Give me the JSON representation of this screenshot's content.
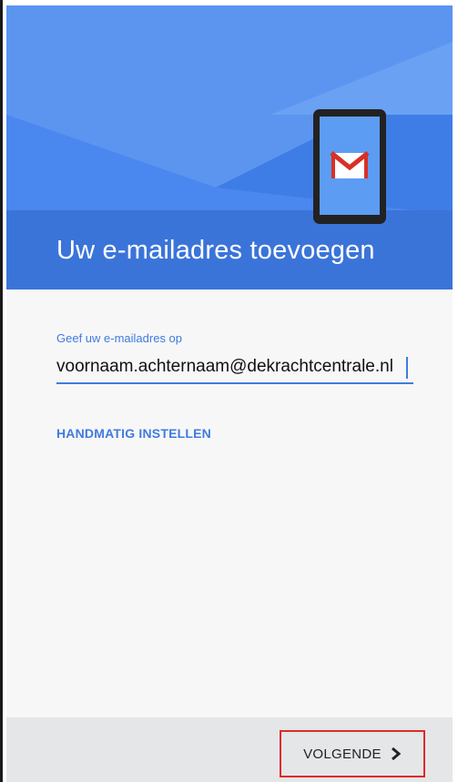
{
  "header": {
    "title": "Uw e-mailadres toevoegen",
    "bg_color": "#4a87ee",
    "illustration": "gmail-phone-icon"
  },
  "form": {
    "email_label": "Geef uw e-mailadres op",
    "email_value": "voornaam.achternaam@dekrachtcentrale.nl",
    "manual_setup": "HANDMATIG INSTELLEN"
  },
  "footer": {
    "next_label": "VOLGENDE",
    "next_icon": "chevron-right-icon",
    "highlight_color": "#e02a2a"
  }
}
